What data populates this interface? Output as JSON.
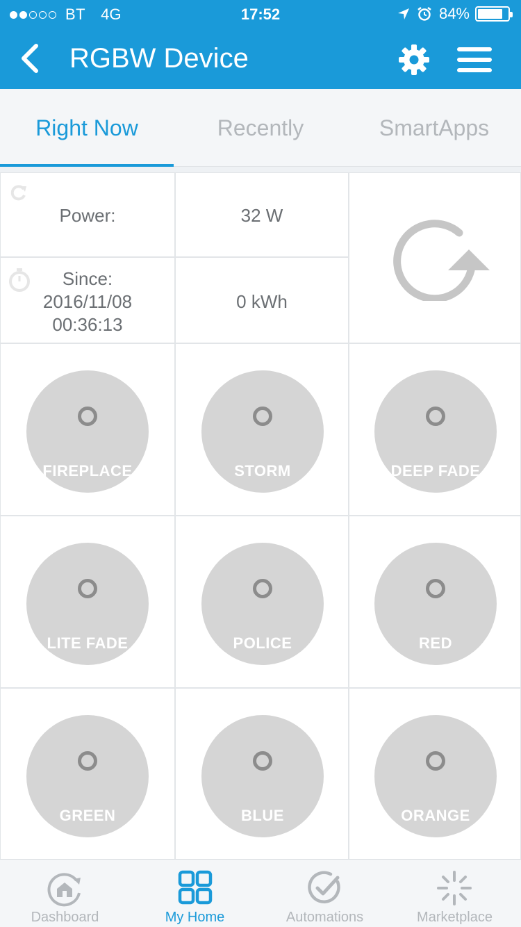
{
  "status_bar": {
    "carrier": "BT",
    "network": "4G",
    "time": "17:52",
    "battery": "84%",
    "battery_level": 0.84
  },
  "nav": {
    "title": "RGBW Device",
    "back_icon": "chevron-left-icon",
    "settings_icon": "gear-icon",
    "menu_icon": "hamburger-icon"
  },
  "tabs": [
    {
      "label": "Right Now",
      "active": true
    },
    {
      "label": "Recently",
      "active": false
    },
    {
      "label": "SmartApps",
      "active": false
    }
  ],
  "power": {
    "label": "Power:",
    "value": "32 W"
  },
  "energy": {
    "label_since": "Since:",
    "date": "2016/11/08",
    "time": "00:36:13",
    "value": "0 kWh"
  },
  "buttons": [
    {
      "label": "FIREPLACE"
    },
    {
      "label": "STORM"
    },
    {
      "label": "DEEP FADE"
    },
    {
      "label": "LITE FADE"
    },
    {
      "label": "POLICE"
    },
    {
      "label": "RED"
    },
    {
      "label": "GREEN"
    },
    {
      "label": "BLUE"
    },
    {
      "label": "ORANGE"
    }
  ],
  "bottom_nav": [
    {
      "label": "Dashboard",
      "icon": "dashboard-icon",
      "active": false
    },
    {
      "label": "My Home",
      "icon": "grid-icon",
      "active": true
    },
    {
      "label": "Automations",
      "icon": "check-circle-icon",
      "active": false
    },
    {
      "label": "Marketplace",
      "icon": "sparkle-icon",
      "active": false
    }
  ],
  "colors": {
    "accent": "#1a9ad9",
    "inactive": "#b3b7bb",
    "tile": "#d5d5d5"
  }
}
